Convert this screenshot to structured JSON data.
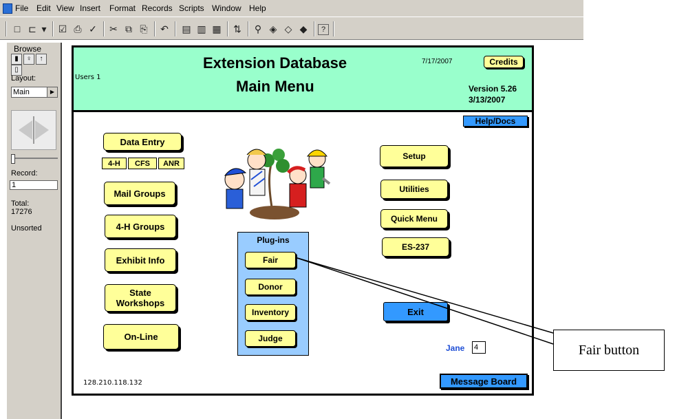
{
  "menu": [
    "File",
    "Edit",
    "View",
    "Insert",
    "Format",
    "Records",
    "Scripts",
    "Window",
    "Help"
  ],
  "status": {
    "mode": "Browse",
    "layout_label": "Layout:",
    "layout_value": "Main",
    "record_label": "Record:",
    "record_value": "1",
    "total_label": "Total:",
    "total_value": "17276",
    "sort_status": "Unsorted"
  },
  "header": {
    "title": "Extension Database",
    "subtitle": "Main Menu",
    "users": "Users 1",
    "date": "7/17/2007",
    "credits": "Credits",
    "version": "Version 5.26",
    "version_date": "3/13/2007"
  },
  "main": {
    "help_docs": "Help/Docs",
    "data_entry": "Data Entry",
    "sub_4h": "4-H",
    "sub_cfs": "CFS",
    "sub_anr": "ANR",
    "mail_groups": "Mail Groups",
    "h4_groups": "4-H Groups",
    "exhibit_info": "Exhibit Info",
    "state_workshops_1": "State",
    "state_workshops_2": "Workshops",
    "online": "On-Line",
    "plugins_title": "Plug-ins",
    "fair": "Fair",
    "donor": "Donor",
    "inventory": "Inventory",
    "judge": "Judge",
    "setup": "Setup",
    "utilities": "Utilities",
    "quick_menu": "Quick Menu",
    "es237": "ES-237",
    "exit": "Exit",
    "user_name": "Jane",
    "user_num": "4",
    "ip": "128.210.118.132",
    "message_board": "Message Board"
  },
  "callout": "Fair button"
}
